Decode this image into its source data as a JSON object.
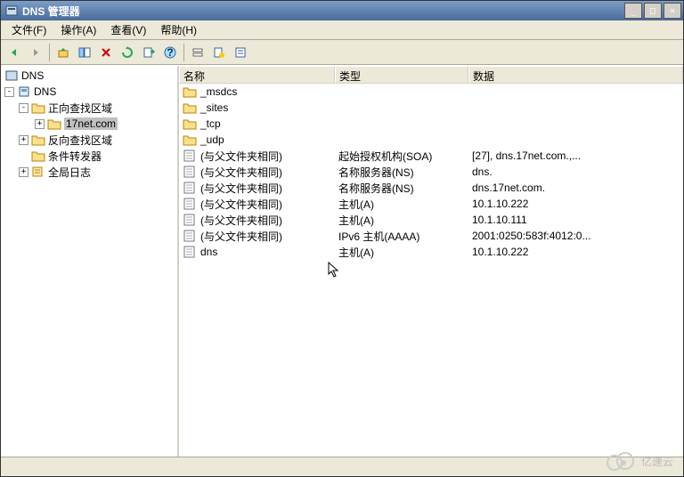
{
  "window": {
    "title": "DNS 管理器"
  },
  "menu": {
    "file": "文件(F)",
    "action": "操作(A)",
    "view": "查看(V)",
    "help": "帮助(H)"
  },
  "tree": {
    "root": "DNS",
    "server": "DNS",
    "forward_zones": "正向查找区域",
    "zone": "17net.com",
    "reverse_zones": "反向查找区域",
    "conditional_forwarders": "条件转发器",
    "global_log": "全局日志"
  },
  "list": {
    "cols": {
      "name": "名称",
      "type": "类型",
      "data": "数据"
    },
    "rows": [
      {
        "icon": "folder",
        "name": "_msdcs",
        "type": "",
        "data": ""
      },
      {
        "icon": "folder",
        "name": "_sites",
        "type": "",
        "data": ""
      },
      {
        "icon": "folder",
        "name": "_tcp",
        "type": "",
        "data": ""
      },
      {
        "icon": "folder",
        "name": "_udp",
        "type": "",
        "data": ""
      },
      {
        "icon": "record",
        "name": "(与父文件夹相同)",
        "type": "起始授权机构(SOA)",
        "data": "[27], dns.17net.com.,..."
      },
      {
        "icon": "record",
        "name": "(与父文件夹相同)",
        "type": "名称服务器(NS)",
        "data": "dns."
      },
      {
        "icon": "record",
        "name": "(与父文件夹相同)",
        "type": "名称服务器(NS)",
        "data": "dns.17net.com."
      },
      {
        "icon": "record",
        "name": "(与父文件夹相同)",
        "type": "主机(A)",
        "data": "10.1.10.222"
      },
      {
        "icon": "record",
        "name": "(与父文件夹相同)",
        "type": "主机(A)",
        "data": "10.1.10.111"
      },
      {
        "icon": "record",
        "name": "(与父文件夹相同)",
        "type": "IPv6 主机(AAAA)",
        "data": "2001:0250:583f:4012:0..."
      },
      {
        "icon": "record",
        "name": "dns",
        "type": "主机(A)",
        "data": "10.1.10.222"
      }
    ]
  },
  "watermark": "亿速云"
}
